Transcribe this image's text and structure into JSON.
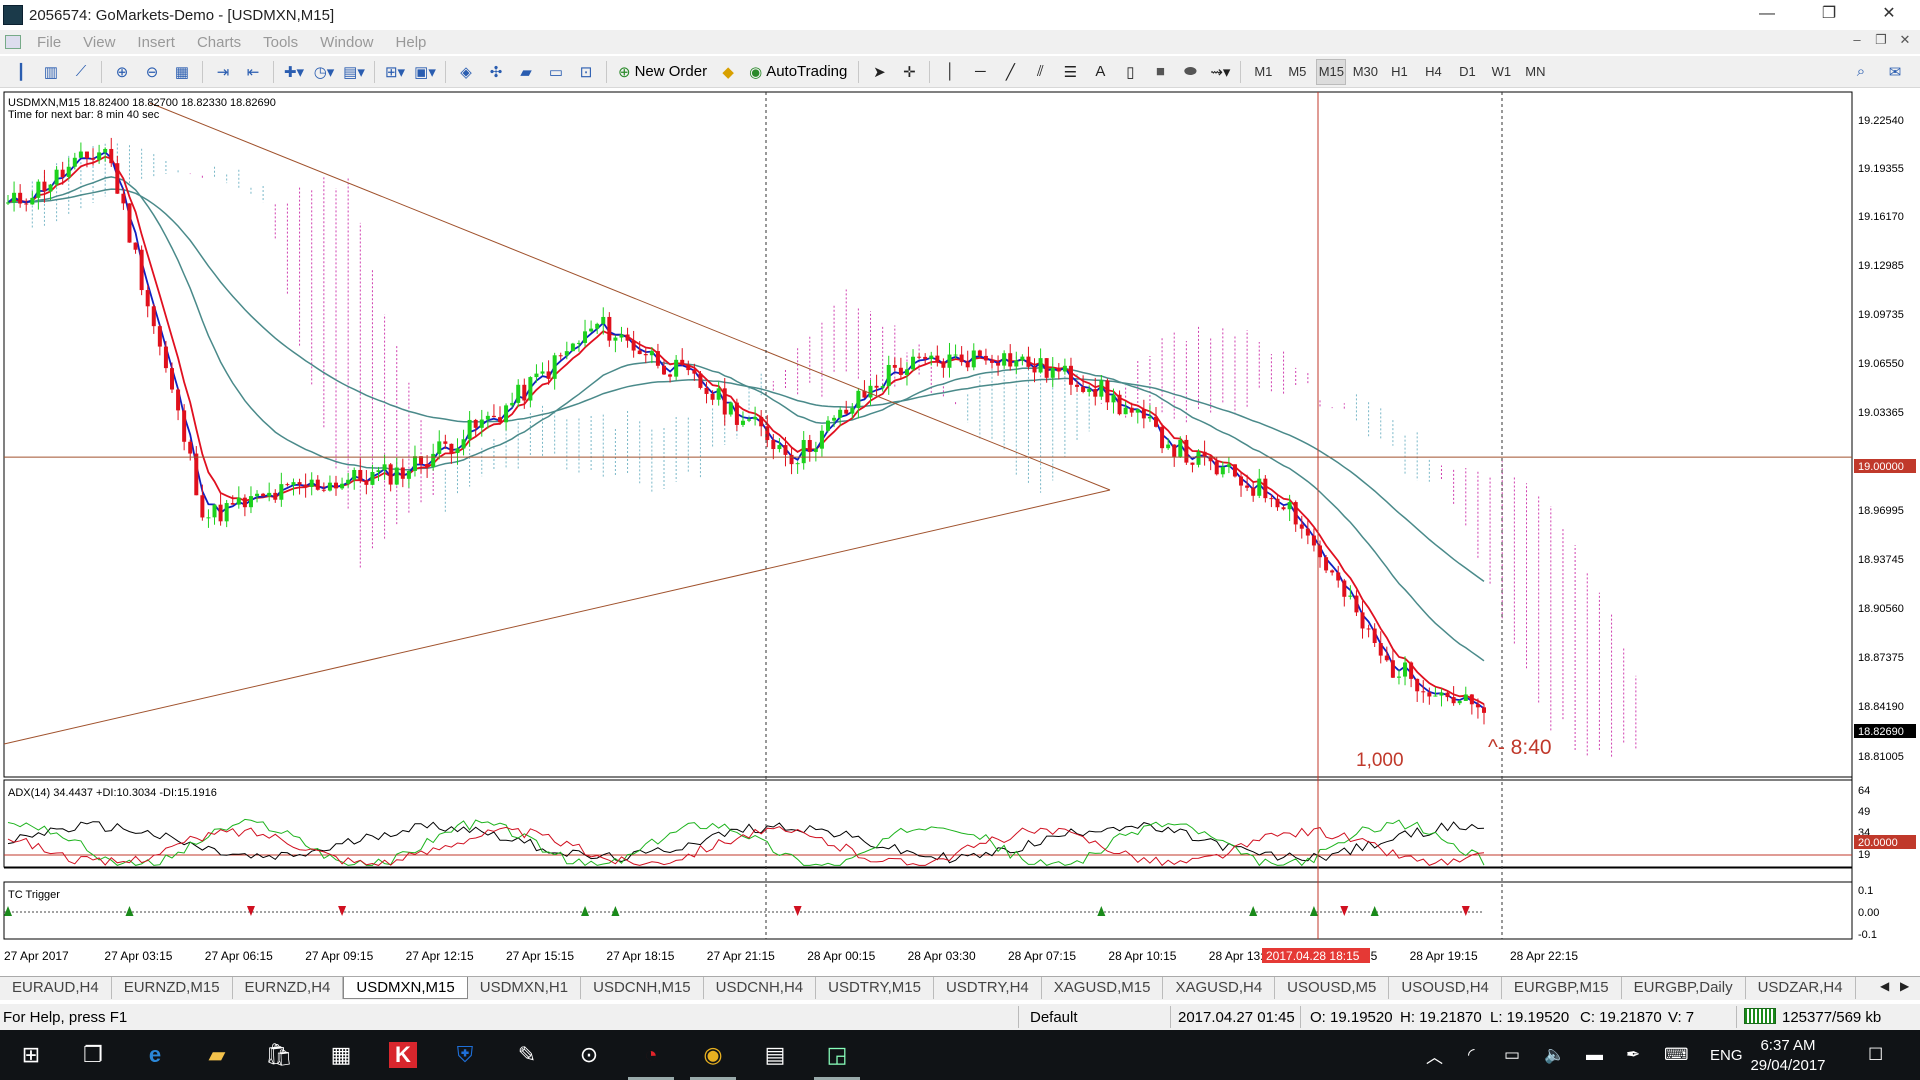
{
  "window": {
    "title": "2056574: GoMarkets-Demo - [USDMXN,M15]",
    "controls": {
      "minimize": "—",
      "restore": "❐",
      "close": "✕"
    }
  },
  "menu": {
    "items": [
      "File",
      "View",
      "Insert",
      "Charts",
      "Tools",
      "Window",
      "Help"
    ],
    "mdi_controls": {
      "minimize": "–",
      "restore": "❐",
      "close": "✕"
    }
  },
  "toolbar": {
    "new_order": "New Order",
    "autotrading": "AutoTrading",
    "timeframes": [
      "M1",
      "M5",
      "M15",
      "M30",
      "H1",
      "H4",
      "D1",
      "W1",
      "MN"
    ],
    "active_timeframe": "M15",
    "drawing_text_tool": "A"
  },
  "chart": {
    "header": "USDMXN,M15  18.82400 18.82700 18.82330 18.82690",
    "next_bar": "Time for next bar: 8 min 40 sec",
    "price_ticks": [
      "19.22540",
      "19.19355",
      "19.16170",
      "19.12985",
      "19.09735",
      "19.06550",
      "19.03365",
      "19.00000",
      "18.96995",
      "18.93745",
      "18.90560",
      "18.87375",
      "18.84190",
      "18.82690",
      "18.81005"
    ],
    "price_marker_level": "19.00000",
    "current_price": "18.82690",
    "annotation_volume": "1,000",
    "annotation_timer": "^- 8:40",
    "time_ticks": [
      "27 Apr 2017",
      "27 Apr 03:15",
      "27 Apr 06:15",
      "27 Apr 09:15",
      "27 Apr 12:15",
      "27 Apr 15:15",
      "27 Apr 18:15",
      "27 Apr 21:15",
      "28 Apr 00:15",
      "28 Apr 03:30",
      "28 Apr 07:15",
      "28 Apr 10:15",
      "28 Apr 13:15",
      "28 Apr 16:15",
      "28 Apr 19:15",
      "28 Apr 22:15"
    ],
    "crosshair_time": "2017.04.28 18:15",
    "colors": {
      "bull": "#1dd11d",
      "bear": "#e0101c",
      "ma_fast": "#1020c0",
      "ma_mid": "#e01020",
      "ma_slow": "#4a8a8a",
      "cloud_up": "#7ab8c8",
      "cloud_down": "#d040b0",
      "trend": "#a0522d",
      "crosshair": "#c0392b"
    }
  },
  "adx": {
    "label": "ADX(14) 34.4437 +DI:10.3034 -DI:15.1916",
    "ticks": [
      "64",
      "49",
      "34",
      "19",
      "20.0000"
    ],
    "level_label": "20.0000"
  },
  "tc": {
    "label": "TC Trigger",
    "ticks": [
      "0.1",
      "0.00",
      "-0.1"
    ]
  },
  "chart_data": {
    "type": "candlestick",
    "symbol": "USDMXN",
    "timeframe": "M15",
    "ohlc_last": {
      "open": 18.824,
      "high": 18.827,
      "low": 18.8233,
      "close": 18.8269
    },
    "ylim": [
      18.795,
      19.235
    ],
    "x": [
      "27 Apr 2017",
      "27 Apr 03:15",
      "27 Apr 06:15",
      "27 Apr 09:15",
      "27 Apr 12:15",
      "27 Apr 15:15",
      "27 Apr 18:15",
      "27 Apr 21:15",
      "28 Apr 00:15",
      "28 Apr 03:30",
      "28 Apr 07:15",
      "28 Apr 10:15",
      "28 Apr 13:15",
      "28 Apr 16:15",
      "28 Apr 19:15",
      "28 Apr 22:15"
    ],
    "close_approx": [
      19.17,
      19.21,
      18.96,
      18.98,
      18.99,
      19.03,
      19.09,
      19.05,
      19.0,
      19.06,
      19.07,
      19.05,
      19.0,
      18.97,
      18.86,
      18.827
    ],
    "horizontal_level": 19.0,
    "adx": {
      "adx": 34.4437,
      "plus_di": 10.3034,
      "minus_di": 15.1916,
      "level": 20.0
    }
  },
  "tabs": {
    "items": [
      "EURAUD,H4",
      "EURNZD,M15",
      "EURNZD,H4",
      "USDMXN,M15",
      "USDMXN,H1",
      "USDCNH,M15",
      "USDCNH,H4",
      "USDTRY,M15",
      "USDTRY,H4",
      "XAGUSD,M15",
      "XAGUSD,H4",
      "USOUSD,M5",
      "USOUSD,H4",
      "EURGBP,M15",
      "EURGBP,Daily",
      "USDZAR,H4"
    ],
    "active": "USDMXN,M15",
    "nav_left": "◀",
    "nav_right": "▶"
  },
  "status": {
    "help": "For Help, press F1",
    "profile": "Default",
    "time": "2017.04.27 01:45",
    "open": "O: 19.19520",
    "high": "H: 19.21870",
    "low": "L: 19.19520",
    "close": "C: 19.21870",
    "volume": "V: 7",
    "traffic": "125377/569 kb"
  },
  "taskbar": {
    "language": "ENG",
    "time": "6:37 AM",
    "date": "29/04/2017"
  }
}
